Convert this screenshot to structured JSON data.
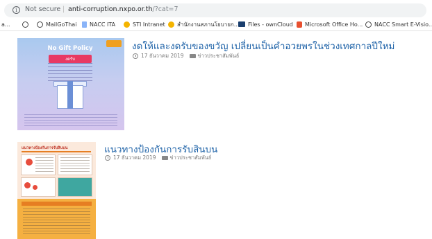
{
  "browser": {
    "security_label": "Not secure",
    "url_host": "anti-corruption.nxpo.or.th",
    "url_path": "/?cat=7",
    "bookmarks": [
      {
        "label": "a...",
        "icon": "web-icon"
      },
      {
        "label": "",
        "icon": "web-icon"
      },
      {
        "label": "MailGoThai",
        "icon": "web-icon"
      },
      {
        "label": "NACC ITA",
        "icon": "document-icon"
      },
      {
        "label": "STI Intranet",
        "icon": "sti-logo-icon"
      },
      {
        "label": "สำนักงานสภานโยบายก...",
        "icon": "thai-org-logo-icon"
      },
      {
        "label": "Files - ownCloud",
        "icon": "cloud-icon"
      },
      {
        "label": "Microsoft Office Ho...",
        "icon": "office-icon"
      },
      {
        "label": "NACC Smart E-Visio...",
        "icon": "web-icon"
      }
    ]
  },
  "posts": [
    {
      "title": "งดให้และงดรับของขวัญ เปลี่ยนเป็นคำอวยพรในช่วงเทศกาลปีใหม่",
      "date": "17 ธันวาคม 2019",
      "category": "ข่าวประชาสัมพันธ์",
      "thumbnail": {
        "heading": "No Gift Policy",
        "subheading": "งดรับ"
      }
    },
    {
      "title": "แนวทางป้องกันการรับสินบน",
      "date": "17 ธันวาคม 2019",
      "category": "ข่าวประชาสัมพันธ์",
      "thumbnail": {
        "heading": "แนวทางป้องกันการรับสินบน"
      }
    }
  ],
  "colors": {
    "link": "#1f63a8",
    "meta": "#777777"
  }
}
